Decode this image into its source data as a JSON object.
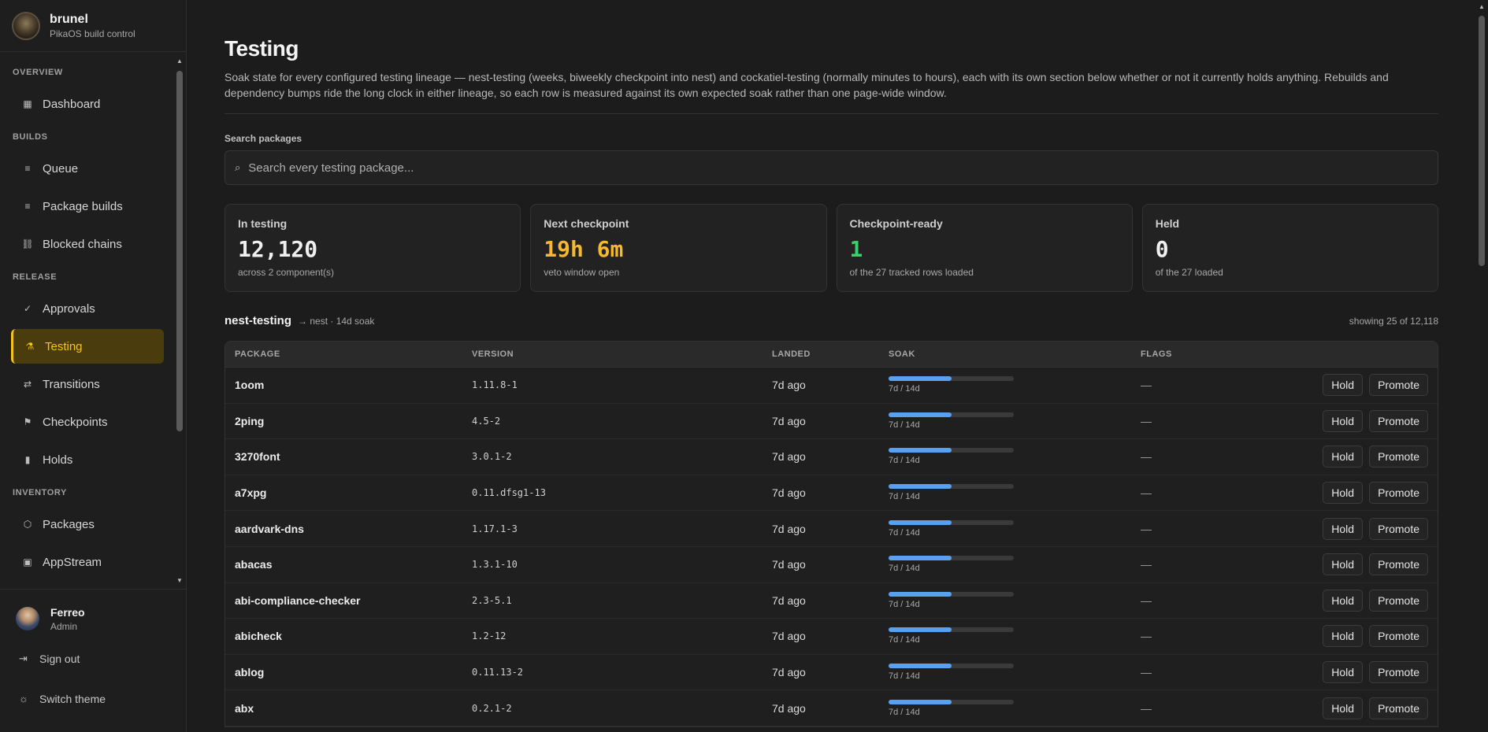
{
  "brand": {
    "name": "brunel",
    "subtitle": "PikaOS build control"
  },
  "nav": {
    "sections": [
      {
        "label": "OVERVIEW",
        "items": [
          {
            "label": "Dashboard",
            "icon": "grid-icon"
          }
        ]
      },
      {
        "label": "BUILDS",
        "items": [
          {
            "label": "Queue",
            "icon": "list-icon"
          },
          {
            "label": "Package builds",
            "icon": "list-icon"
          },
          {
            "label": "Blocked chains",
            "icon": "link-icon"
          }
        ]
      },
      {
        "label": "RELEASE",
        "items": [
          {
            "label": "Approvals",
            "icon": "check-icon"
          },
          {
            "label": "Testing",
            "icon": "flask-icon",
            "active": true
          },
          {
            "label": "Transitions",
            "icon": "arrows-icon"
          },
          {
            "label": "Checkpoints",
            "icon": "flag-icon"
          },
          {
            "label": "Holds",
            "icon": "pause-icon"
          }
        ]
      },
      {
        "label": "INVENTORY",
        "items": [
          {
            "label": "Packages",
            "icon": "cube-icon"
          },
          {
            "label": "AppStream",
            "icon": "app-icon"
          }
        ]
      }
    ]
  },
  "user": {
    "name": "Ferreo",
    "role": "Admin",
    "sign_out": "Sign out",
    "switch_theme": "Switch theme"
  },
  "page": {
    "title": "Testing",
    "description": "Soak state for every configured testing lineage — nest-testing (weeks, biweekly checkpoint into nest) and cockatiel-testing (normally minutes to hours), each with its own section below whether or not it currently holds anything. Rebuilds and dependency bumps ride the long clock in either lineage, so each row is measured against its own expected soak rather than one page-wide window.",
    "search_label": "Search packages",
    "search_placeholder": "Search every testing package..."
  },
  "stats": [
    {
      "label": "In testing",
      "value": "12,120",
      "sub": "across 2 component(s)",
      "color": "#f0f0f0"
    },
    {
      "label": "Next checkpoint",
      "value": "19h 6m",
      "sub": "veto window open",
      "color": "#f5b82e"
    },
    {
      "label": "Checkpoint-ready",
      "value": "1",
      "sub": "of the 27 tracked rows loaded",
      "color": "#3ccf6e"
    },
    {
      "label": "Held",
      "value": "0",
      "sub": "of the 27 loaded",
      "color": "#f0f0f0"
    }
  ],
  "section": {
    "title": "nest-testing",
    "meta": "→ nest · 14d soak",
    "count": "showing 25 of 12,118"
  },
  "table": {
    "headers": {
      "package": "PACKAGE",
      "version": "VERSION",
      "landed": "LANDED",
      "soak": "SOAK",
      "flags": "FLAGS"
    },
    "hold_label": "Hold",
    "promote_label": "Promote",
    "rows": [
      {
        "package": "1oom",
        "version": "1.11.8-1",
        "landed": "7d ago",
        "soak": "7d / 14d",
        "soak_fraction": 0.5,
        "flags": "—"
      },
      {
        "package": "2ping",
        "version": "4.5-2",
        "landed": "7d ago",
        "soak": "7d / 14d",
        "soak_fraction": 0.5,
        "flags": "—"
      },
      {
        "package": "3270font",
        "version": "3.0.1-2",
        "landed": "7d ago",
        "soak": "7d / 14d",
        "soak_fraction": 0.5,
        "flags": "—"
      },
      {
        "package": "a7xpg",
        "version": "0.11.dfsg1-13",
        "landed": "7d ago",
        "soak": "7d / 14d",
        "soak_fraction": 0.5,
        "flags": "—"
      },
      {
        "package": "aardvark-dns",
        "version": "1.17.1-3",
        "landed": "7d ago",
        "soak": "7d / 14d",
        "soak_fraction": 0.5,
        "flags": "—"
      },
      {
        "package": "abacas",
        "version": "1.3.1-10",
        "landed": "7d ago",
        "soak": "7d / 14d",
        "soak_fraction": 0.5,
        "flags": "—"
      },
      {
        "package": "abi-compliance-checker",
        "version": "2.3-5.1",
        "landed": "7d ago",
        "soak": "7d / 14d",
        "soak_fraction": 0.5,
        "flags": "—"
      },
      {
        "package": "abicheck",
        "version": "1.2-12",
        "landed": "7d ago",
        "soak": "7d / 14d",
        "soak_fraction": 0.5,
        "flags": "—"
      },
      {
        "package": "ablog",
        "version": "0.11.13-2",
        "landed": "7d ago",
        "soak": "7d / 14d",
        "soak_fraction": 0.5,
        "flags": "—"
      },
      {
        "package": "abx",
        "version": "0.2.1-2",
        "landed": "7d ago",
        "soak": "7d / 14d",
        "soak_fraction": 0.5,
        "flags": "—"
      }
    ]
  }
}
